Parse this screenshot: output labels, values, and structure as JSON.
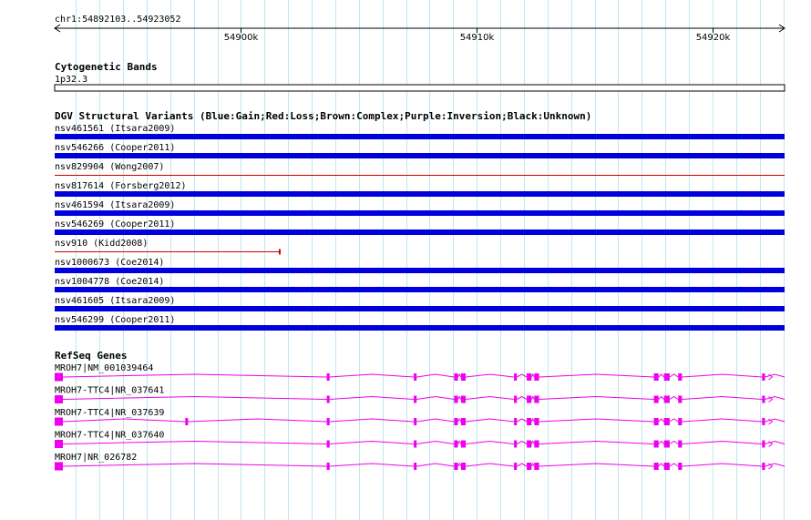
{
  "ruler": {
    "range_label": "chr1:54892103..54923052",
    "start": 54892103,
    "end": 54923052,
    "ticks": [
      {
        "pos": 54900000,
        "label": "54900k"
      },
      {
        "pos": 54910000,
        "label": "54910k"
      },
      {
        "pos": 54920000,
        "label": "54920k"
      }
    ]
  },
  "cytoband": {
    "title": "Cytogenetic Bands",
    "band": "1p32.3"
  },
  "dgv": {
    "title": "DGV Structural Variants (Blue:Gain;Red:Loss;Brown:Complex;Purple:Inversion;Black:Unknown)",
    "colors": {
      "gain": "#0000dd",
      "loss": "#cc0000"
    },
    "variants": [
      {
        "name": "nsv461561 (Itsara2009)",
        "type": "gain",
        "start": 54892103,
        "end": 54923052
      },
      {
        "name": "nsv546266 (Cooper2011)",
        "type": "gain",
        "start": 54892103,
        "end": 54923052
      },
      {
        "name": "nsv829904 (Wong2007)",
        "type": "loss",
        "start": 54892103,
        "end": 54923052
      },
      {
        "name": "nsv817614 (Forsberg2012)",
        "type": "gain",
        "start": 54892103,
        "end": 54923052
      },
      {
        "name": "nsv461594 (Itsara2009)",
        "type": "gain",
        "start": 54892103,
        "end": 54923052
      },
      {
        "name": "nsv546269 (Cooper2011)",
        "type": "gain",
        "start": 54892103,
        "end": 54923052
      },
      {
        "name": "nsv910 (Kidd2008)",
        "type": "loss",
        "start": 54892103,
        "end": 54901645
      },
      {
        "name": "nsv1000673 (Coe2014)",
        "type": "gain",
        "start": 54892103,
        "end": 54923052
      },
      {
        "name": "nsv1004778 (Coe2014)",
        "type": "gain",
        "start": 54892103,
        "end": 54923052
      },
      {
        "name": "nsv461605 (Itsara2009)",
        "type": "gain",
        "start": 54892103,
        "end": 54923052
      },
      {
        "name": "nsv546299 (Cooper2011)",
        "type": "gain",
        "start": 54892103,
        "end": 54923052
      }
    ]
  },
  "refseq": {
    "title": "RefSeq Genes",
    "color": "#ee00ee",
    "genes": [
      {
        "name": "MROH7|NM_001039464",
        "exons": [
          [
            54892103,
            54892450
          ],
          [
            54903640,
            54903760
          ],
          [
            54907330,
            54907450
          ],
          [
            54909040,
            54909200
          ],
          [
            54909330,
            54909530
          ],
          [
            54911580,
            54911700
          ],
          [
            54912120,
            54912320
          ],
          [
            54912440,
            54912640
          ],
          [
            54917510,
            54917710
          ],
          [
            54917940,
            54918180
          ],
          [
            54918540,
            54918700
          ],
          [
            54922100,
            54922220
          ]
        ],
        "end": 54923052
      },
      {
        "name": "MROH7-TTC4|NR_037641",
        "exons": [
          [
            54892103,
            54892450
          ],
          [
            54903640,
            54903760
          ],
          [
            54907330,
            54907450
          ],
          [
            54909040,
            54909200
          ],
          [
            54909330,
            54909530
          ],
          [
            54911580,
            54911700
          ],
          [
            54912120,
            54912320
          ],
          [
            54912440,
            54912640
          ],
          [
            54917510,
            54917710
          ],
          [
            54917940,
            54918180
          ],
          [
            54918540,
            54918700
          ],
          [
            54922100,
            54922220
          ]
        ],
        "end": 54923052
      },
      {
        "name": "MROH7-TTC4|NR_037639",
        "exons": [
          [
            54892103,
            54892450
          ],
          [
            54897640,
            54897760
          ],
          [
            54903640,
            54903760
          ],
          [
            54907330,
            54907450
          ],
          [
            54909040,
            54909200
          ],
          [
            54909330,
            54909530
          ],
          [
            54911580,
            54911700
          ],
          [
            54912120,
            54912320
          ],
          [
            54912440,
            54912640
          ],
          [
            54917510,
            54917710
          ],
          [
            54917940,
            54918180
          ],
          [
            54918540,
            54918700
          ],
          [
            54922100,
            54922220
          ]
        ],
        "end": 54923052
      },
      {
        "name": "MROH7-TTC4|NR_037640",
        "exons": [
          [
            54892103,
            54892450
          ],
          [
            54903640,
            54903760
          ],
          [
            54907330,
            54907450
          ],
          [
            54909040,
            54909200
          ],
          [
            54909330,
            54909530
          ],
          [
            54911580,
            54911700
          ],
          [
            54912120,
            54912320
          ],
          [
            54912440,
            54912640
          ],
          [
            54917510,
            54917710
          ],
          [
            54917940,
            54918180
          ],
          [
            54918540,
            54918700
          ],
          [
            54922100,
            54922220
          ]
        ],
        "end": 54923052
      },
      {
        "name": "MROH7|NR_026782",
        "exons": [
          [
            54892103,
            54892450
          ],
          [
            54903640,
            54903760
          ],
          [
            54907330,
            54907450
          ],
          [
            54909040,
            54909200
          ],
          [
            54909330,
            54909530
          ],
          [
            54911580,
            54911700
          ],
          [
            54912120,
            54912320
          ],
          [
            54912440,
            54912640
          ],
          [
            54917510,
            54917710
          ],
          [
            54917940,
            54918180
          ],
          [
            54918540,
            54918700
          ],
          [
            54922100,
            54922220
          ]
        ],
        "end": 54923052
      }
    ]
  }
}
